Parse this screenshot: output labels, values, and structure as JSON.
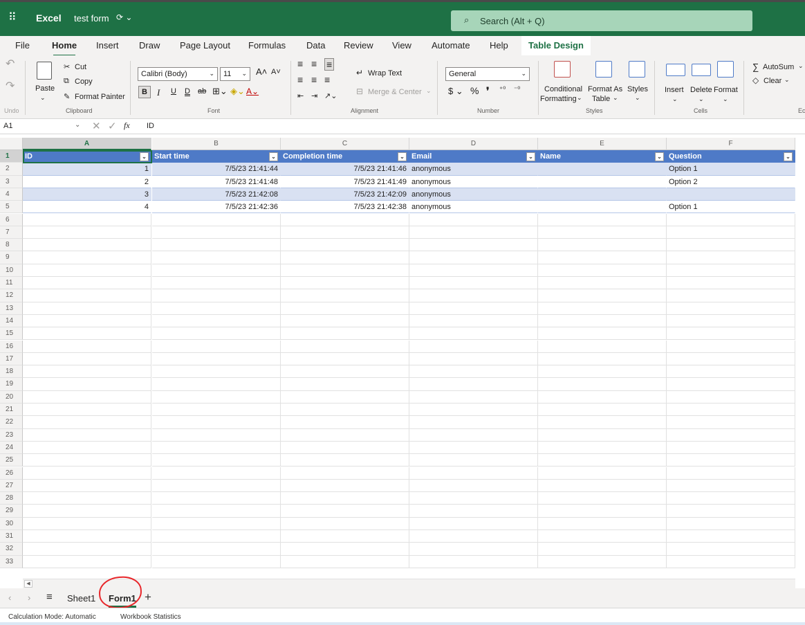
{
  "titlebar": {
    "app_name": "Excel",
    "doc_name": "test form",
    "search_label": "Search (Alt + Q)"
  },
  "tabs": [
    {
      "label": "File"
    },
    {
      "label": "Home"
    },
    {
      "label": "Insert"
    },
    {
      "label": "Draw"
    },
    {
      "label": "Page Layout"
    },
    {
      "label": "Formulas"
    },
    {
      "label": "Data"
    },
    {
      "label": "Review"
    },
    {
      "label": "View"
    },
    {
      "label": "Automate"
    },
    {
      "label": "Help"
    },
    {
      "label": "Table Design"
    }
  ],
  "ribbon": {
    "undo_label": "Undo",
    "clipboard": {
      "paste": "Paste",
      "cut": "Cut",
      "copy": "Copy",
      "format_painter": "Format Painter",
      "group": "Clipboard"
    },
    "font": {
      "name": "Calibri (Body)",
      "size": "11",
      "group": "Font"
    },
    "alignment": {
      "wrap": "Wrap Text",
      "merge": "Merge & Center",
      "group": "Alignment"
    },
    "number": {
      "format": "General",
      "group": "Number"
    },
    "styles": {
      "conditional_1": "Conditional",
      "conditional_2": "Formatting",
      "format_as_1": "Format As",
      "format_as_2": "Table",
      "styles": "Styles",
      "group": "Styles"
    },
    "cells": {
      "insert": "Insert",
      "delete": "Delete",
      "format": "Format",
      "group": "Cells"
    },
    "editing": {
      "autosum": "AutoSum",
      "clear": "Clear",
      "group_partial": "Ec"
    }
  },
  "formula_bar": {
    "name_box": "A1",
    "fx": "fx",
    "value": "ID"
  },
  "grid": {
    "columns": [
      "A",
      "B",
      "C",
      "D",
      "E",
      "F"
    ],
    "row_count": 33,
    "headers": [
      "ID",
      "Start time",
      "Completion time",
      "Email",
      "Name",
      "Question"
    ],
    "rows": [
      [
        "1",
        "7/5/23 21:41:44",
        "7/5/23 21:41:46",
        "anonymous",
        "",
        "Option 1"
      ],
      [
        "2",
        "7/5/23 21:41:48",
        "7/5/23 21:41:49",
        "anonymous",
        "",
        "Option 2"
      ],
      [
        "3",
        "7/5/23 21:42:08",
        "7/5/23 21:42:09",
        "anonymous",
        "",
        ""
      ],
      [
        "4",
        "7/5/23 21:42:36",
        "7/5/23 21:42:38",
        "anonymous",
        "",
        "Option 1"
      ]
    ]
  },
  "sheets": [
    {
      "label": "Sheet1"
    },
    {
      "label": "Form1"
    }
  ],
  "status": {
    "calc_mode": "Calculation Mode: Automatic",
    "workbook_stats": "Workbook Statistics"
  },
  "colors": {
    "excel_green": "#1e7145",
    "table_header": "#4e7ac7",
    "table_band": "#d9e1f2",
    "annotation": "#e8262a"
  }
}
